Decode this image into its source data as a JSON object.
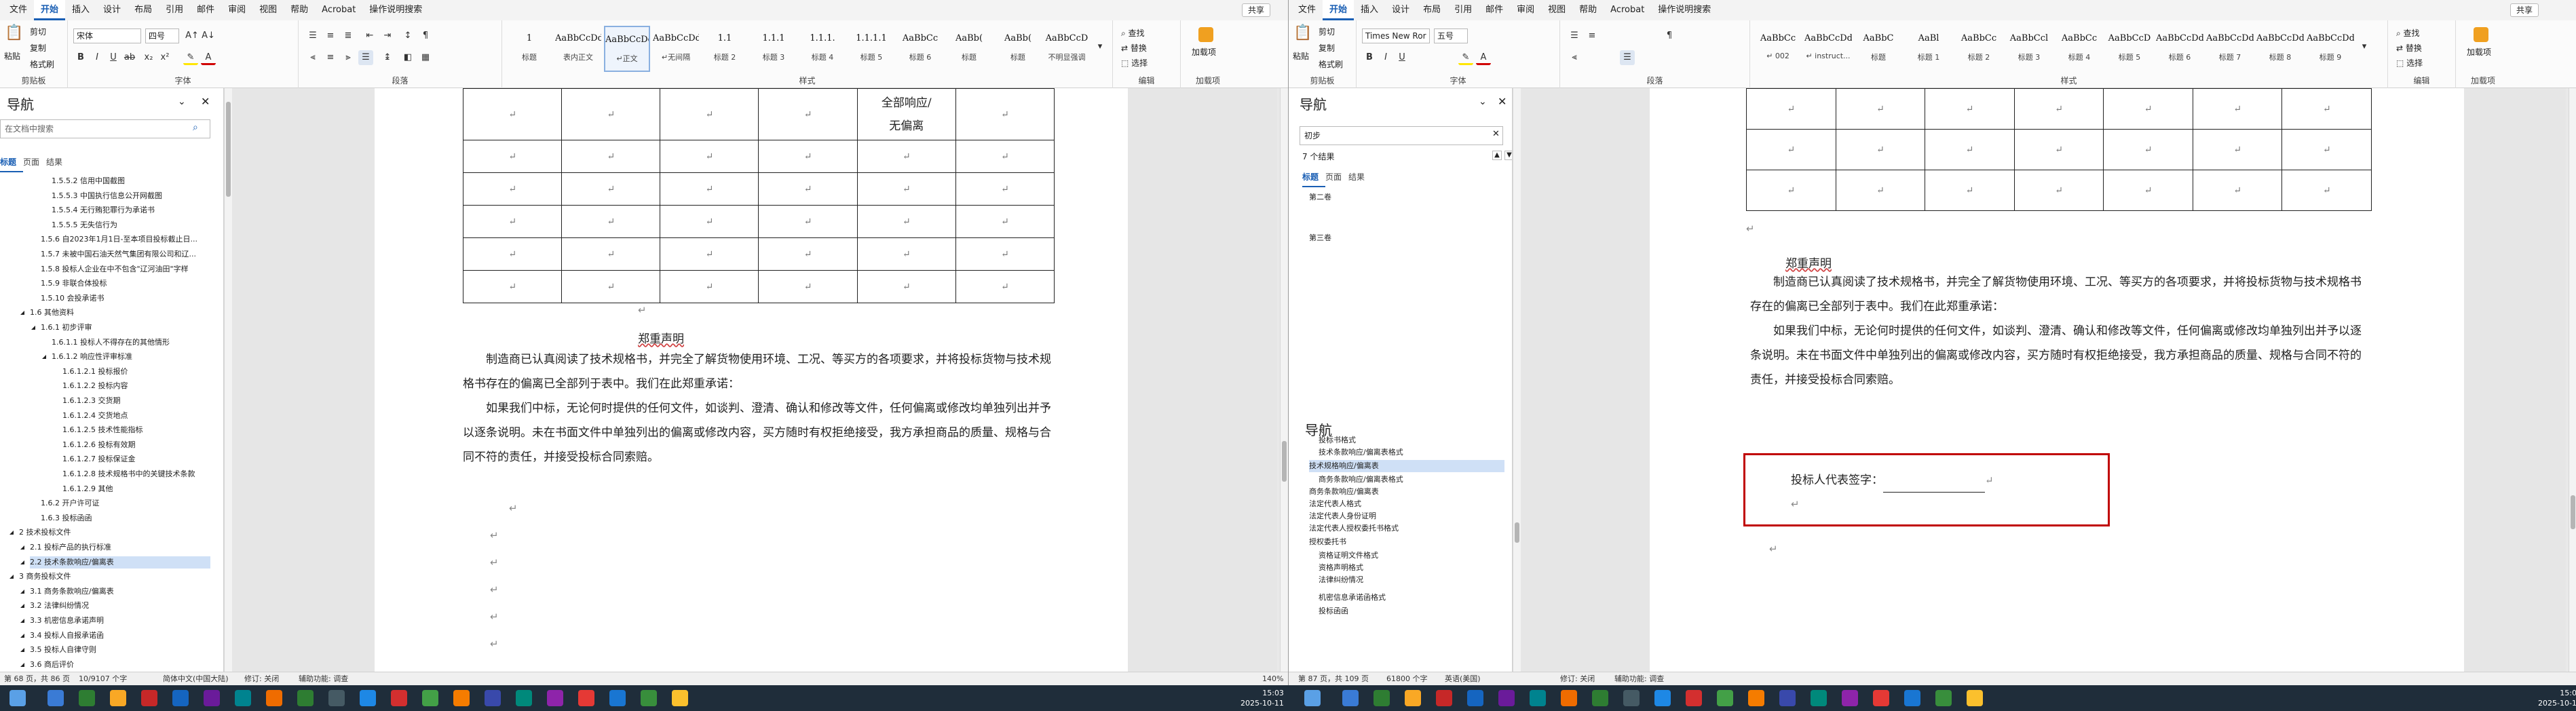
{
  "menu": {
    "tabs": [
      "文件",
      "开始",
      "插入",
      "设计",
      "布局",
      "引用",
      "邮件",
      "审阅",
      "视图",
      "帮助",
      "Acrobat",
      "操作说明搜索"
    ],
    "share": "共享"
  },
  "ribbon": {
    "clipboard": {
      "paste": "粘贴",
      "cut": "剪切",
      "copy": "复制",
      "painter": "格式刷",
      "label": "剪贴板"
    },
    "font": {
      "name_left": "宋体",
      "size_left": "四号",
      "name_right": "Times New Ror",
      "size_right": "五号",
      "label": "字体"
    },
    "paragraph": {
      "label": "段落"
    },
    "styles": {
      "label": "样式",
      "left": [
        {
          "preview": "1",
          "name": "标题"
        },
        {
          "preview": "AaBbCcDd",
          "name": "表内正文"
        },
        {
          "preview": "AaBbCcDd",
          "name": "↵正文"
        },
        {
          "preview": "AaBbCcDd",
          "name": "↵无间隔"
        },
        {
          "preview": "1.1",
          "name": "标题 2"
        },
        {
          "preview": "1.1.1",
          "name": "标题 3"
        },
        {
          "preview": "1.1.1.",
          "name": "标题 4"
        },
        {
          "preview": "1.1.1.1",
          "name": "标题 5"
        },
        {
          "preview": "AaBbCc",
          "name": "标题 6"
        },
        {
          "preview": "AaBb(",
          "name": "标题"
        },
        {
          "preview": "AaBb(",
          "name": "标题"
        },
        {
          "preview": "AaBbCcD",
          "name": "不明显强调"
        }
      ],
      "right": [
        {
          "preview": "AaBbCc",
          "name": "↵ 002"
        },
        {
          "preview": "AaBbCcDdE",
          "name": "↵ instruct..."
        },
        {
          "preview": "AaBbC",
          "name": "标题"
        },
        {
          "preview": "AaBl",
          "name": "标题 1"
        },
        {
          "preview": "AaBbCc",
          "name": "标题 2"
        },
        {
          "preview": "AaBbCcl",
          "name": "标题 3"
        },
        {
          "preview": "AaBbCc",
          "name": "标题 4"
        },
        {
          "preview": "AaBbCcD",
          "name": "标题 5"
        },
        {
          "preview": "AaBbCcDd",
          "name": "标题 6"
        },
        {
          "preview": "AaBbCcDd",
          "name": "标题 7"
        },
        {
          "preview": "AaBbCcDd",
          "name": "标题 8"
        },
        {
          "preview": "AaBbCcDd",
          "name": "标题 9"
        }
      ]
    },
    "editing": {
      "find": "查找",
      "replace": "替换",
      "select": "选择",
      "label": "编辑"
    },
    "addin": {
      "name": "加载项",
      "label": "加载项"
    }
  },
  "nav_left": {
    "title": "导航",
    "search_placeholder": "在文档中搜索",
    "tabs": [
      "标题",
      "页面",
      "结果"
    ],
    "items": [
      "1.5.5.2 信用中国截图",
      "1.5.5.3 中国执行信息公开网截图",
      "1.5.5.4 无行贿犯罪行为承诺书",
      "1.5.5.5 无失信行为",
      "1.5.6 自2023年1月1日-至本项目投标截止日...",
      "1.5.7 未被中国石油天然气集团有限公司和辽...",
      "1.5.8 投标人企业在中不包含\"辽河油田\"字样",
      "1.5.9 非联合体投标",
      "1.5.10 会投承诺书",
      "1.6 其他资料",
      "1.6.1 初步评审",
      "1.6.1.1 投标人不得存在的其他情形",
      "1.6.1.2 响应性评审标准",
      "1.6.1.2.1 投标报价",
      "1.6.1.2.2 投标内容",
      "1.6.1.2.3 交货期",
      "1.6.1.2.4 交货地点",
      "1.6.1.2.5 技术性能指标",
      "1.6.1.2.6 投标有效期",
      "1.6.1.2.7 投标保证金",
      "1.6.1.2.8 技术规格书中的关键技术条款",
      "1.6.1.2.9 其他",
      "1.6.2 开户许可证",
      "1.6.3 投标函函",
      "2 技术投标文件",
      "2.1 投标产品的执行标准",
      "2.2 技术条款响应/偏离表",
      "3 商务投标文件",
      "3.1 商务条款响应/偏离表",
      "3.2 法律纠纷情况",
      "3.3 机密信息承诺声明",
      "3.4 投标人自报承诺函",
      "3.5 投标人自律守则",
      "3.6 商后评价"
    ]
  },
  "nav_right": {
    "title": "导航",
    "search_value": "初步",
    "result_count": "7 个结果",
    "tabs": [
      "标题",
      "页面",
      "结果"
    ],
    "items": [
      "第二卷",
      "第三卷",
      "导航",
      "投标书格式",
      "技术条款响应/偏离表格式",
      "技术规格响应/偏离表",
      "商务条款响应/偏离表格式",
      "商务条款响应/偏离表",
      "法定代表人格式",
      "法定代表人身份证明",
      "法定代表人授权委托书格式",
      "授权委托书",
      "资格证明文件格式",
      "资格声明格式",
      "法律纠纷情况",
      "机密信息承诺函格式",
      "投标函函"
    ]
  },
  "doc_left": {
    "table_cells": [
      "全部响应/",
      "无偏离"
    ],
    "heading": "郑重声明",
    "para1": "制造商已认真阅读了技术规格书，并完全了解货物使用环境、工况、等买方的各项要求，并将投标货物与技术规格书存在的偏离已全部列于表中。我们在此郑重承诺：",
    "para2": "如果我们中标，无论何时提供的任何文件，如谈判、澄清、确认和修改等文件，任何偏离或修改均单独列出并予以逐条说明。未在书面文件中单独列出的偏离或修改内容，买方随时有权拒绝接受，我方承担商品的质量、规格与合同不符的责任，并接受投标合同索赔。"
  },
  "doc_right": {
    "heading": "郑重声明",
    "para1": "制造商已认真阅读了技术规格书，并完全了解货物使用环境、工况、等买方的各项要求，并将投标货物与技术规格书存在的偏离已全部列于表中。我们在此郑重承诺：",
    "para2": "如果我们中标，无论何时提供的任何文件，如谈判、澄清、确认和修改等文件，任何偏离或修改均单独列出并予以逐条说明。未在书面文件中单独列出的偏离或修改内容，买方随时有权拒绝接受，我方承担商品的质量、规格与合同不符的责任，并接受投标合同索赔。",
    "signature": "投标人代表签字："
  },
  "status_left": {
    "page": "第 68 页，共 86 页",
    "words": "10/9107 个字",
    "lang": "简体中文(中国大陆)",
    "revision": "修订: 关闭",
    "accessibility": "辅助功能: 调查",
    "zoom": "140%"
  },
  "status_right": {
    "page": "第 87 页，共 109 页",
    "words": "61800 个字",
    "lang": "英语(美国)",
    "revision": "修订: 关闭",
    "accessibility": "辅助功能: 调查"
  },
  "clock": {
    "time": "15:03",
    "date": "2025-10-11"
  },
  "colors": {
    "accent": "#1a5fb4",
    "highlight_box": "#c00000",
    "taskbar": "#1f2d3a"
  }
}
